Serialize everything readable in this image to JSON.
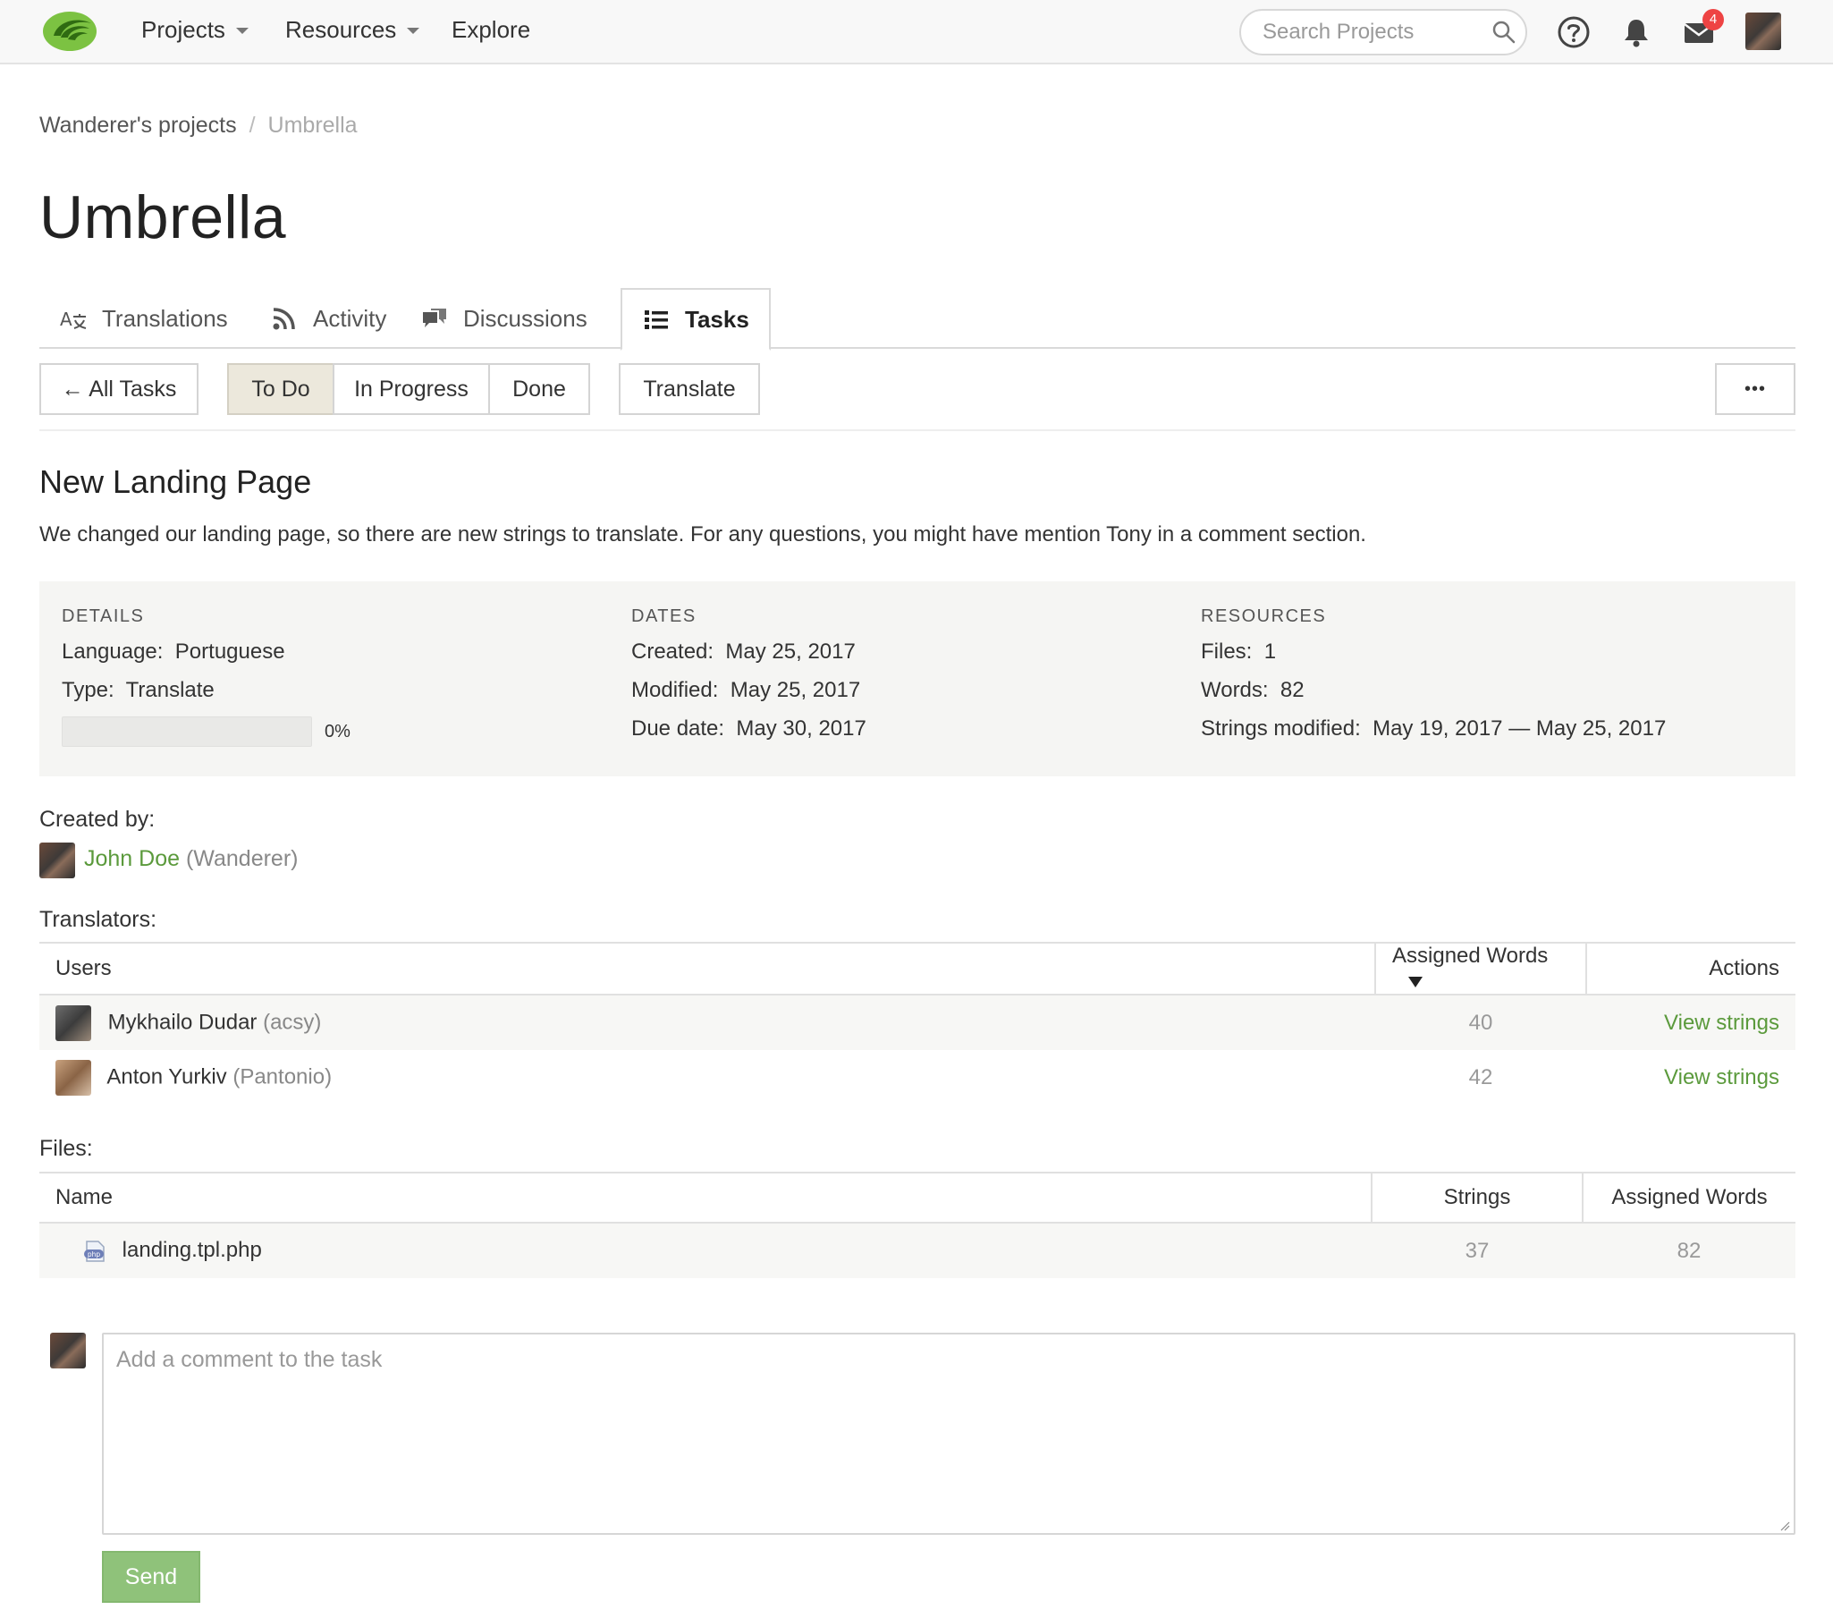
{
  "nav": {
    "items": [
      {
        "label": "Projects"
      },
      {
        "label": "Resources"
      },
      {
        "label": "Explore"
      }
    ],
    "search_placeholder": "Search Projects",
    "mail_count": "4",
    "icons": [
      "help-icon",
      "bell-icon",
      "mail-icon"
    ]
  },
  "breadcrumb": {
    "parent": "Wanderer's projects",
    "separator": "/",
    "current": "Umbrella"
  },
  "page": {
    "title": "Umbrella"
  },
  "tabs": [
    {
      "label": "Translations",
      "icon": "translate-icon"
    },
    {
      "label": "Activity",
      "icon": "rss-icon"
    },
    {
      "label": "Discussions",
      "icon": "chat-icon"
    },
    {
      "label": "Tasks",
      "icon": "list-icon",
      "active": true
    }
  ],
  "filters": {
    "all_tasks": "← All Tasks",
    "todo": "To Do",
    "in_progress": "In Progress",
    "done": "Done",
    "translate": "Translate",
    "more": "•••"
  },
  "task": {
    "title": "New Landing Page",
    "description": "We changed our landing page, so there are new strings to translate. For any questions, you might have mention Tony in a comment section."
  },
  "details": {
    "heading": "DETAILS",
    "language_label": "Language:",
    "language": "Portuguese",
    "type_label": "Type:",
    "type": "Translate",
    "progress": 0,
    "progress_label": "0%"
  },
  "dates": {
    "heading": "DATES",
    "created_label": "Created:",
    "created": "May 25, 2017",
    "modified_label": "Modified:",
    "modified": "May 25, 2017",
    "due_label": "Due date:",
    "due": "May 30, 2017"
  },
  "resources": {
    "heading": "RESOURCES",
    "files_label": "Files:",
    "files": "1",
    "words_label": "Words:",
    "words": "82",
    "strings_modified_label": "Strings modified:",
    "strings_modified": "May 19, 2017 — May 25, 2017"
  },
  "created_by": {
    "label": "Created by:",
    "name": "John Doe",
    "username": "(Wanderer)"
  },
  "translators": {
    "label": "Translators:",
    "columns": {
      "users": "Users",
      "assigned_words": "Assigned Words",
      "actions": "Actions"
    },
    "rows": [
      {
        "name": "Mykhailo Dudar",
        "username": "(acsy)",
        "words": "40",
        "action": "View strings",
        "avatar_color": "#5a5a5a"
      },
      {
        "name": "Anton Yurkiv",
        "username": "(Pantonio)",
        "words": "42",
        "action": "View strings",
        "avatar_color": "#b08a6a"
      }
    ]
  },
  "files": {
    "label": "Files:",
    "columns": {
      "name": "Name",
      "strings": "Strings",
      "assigned_words": "Assigned Words"
    },
    "rows": [
      {
        "name": "landing.tpl.php",
        "strings": "37",
        "words": "82"
      }
    ]
  },
  "comment": {
    "placeholder": "Add a comment to the task",
    "send": "Send"
  },
  "colors": {
    "accent_green": "#5b9a3c",
    "send_button": "#8fc27a",
    "badge_red": "#e44444"
  }
}
